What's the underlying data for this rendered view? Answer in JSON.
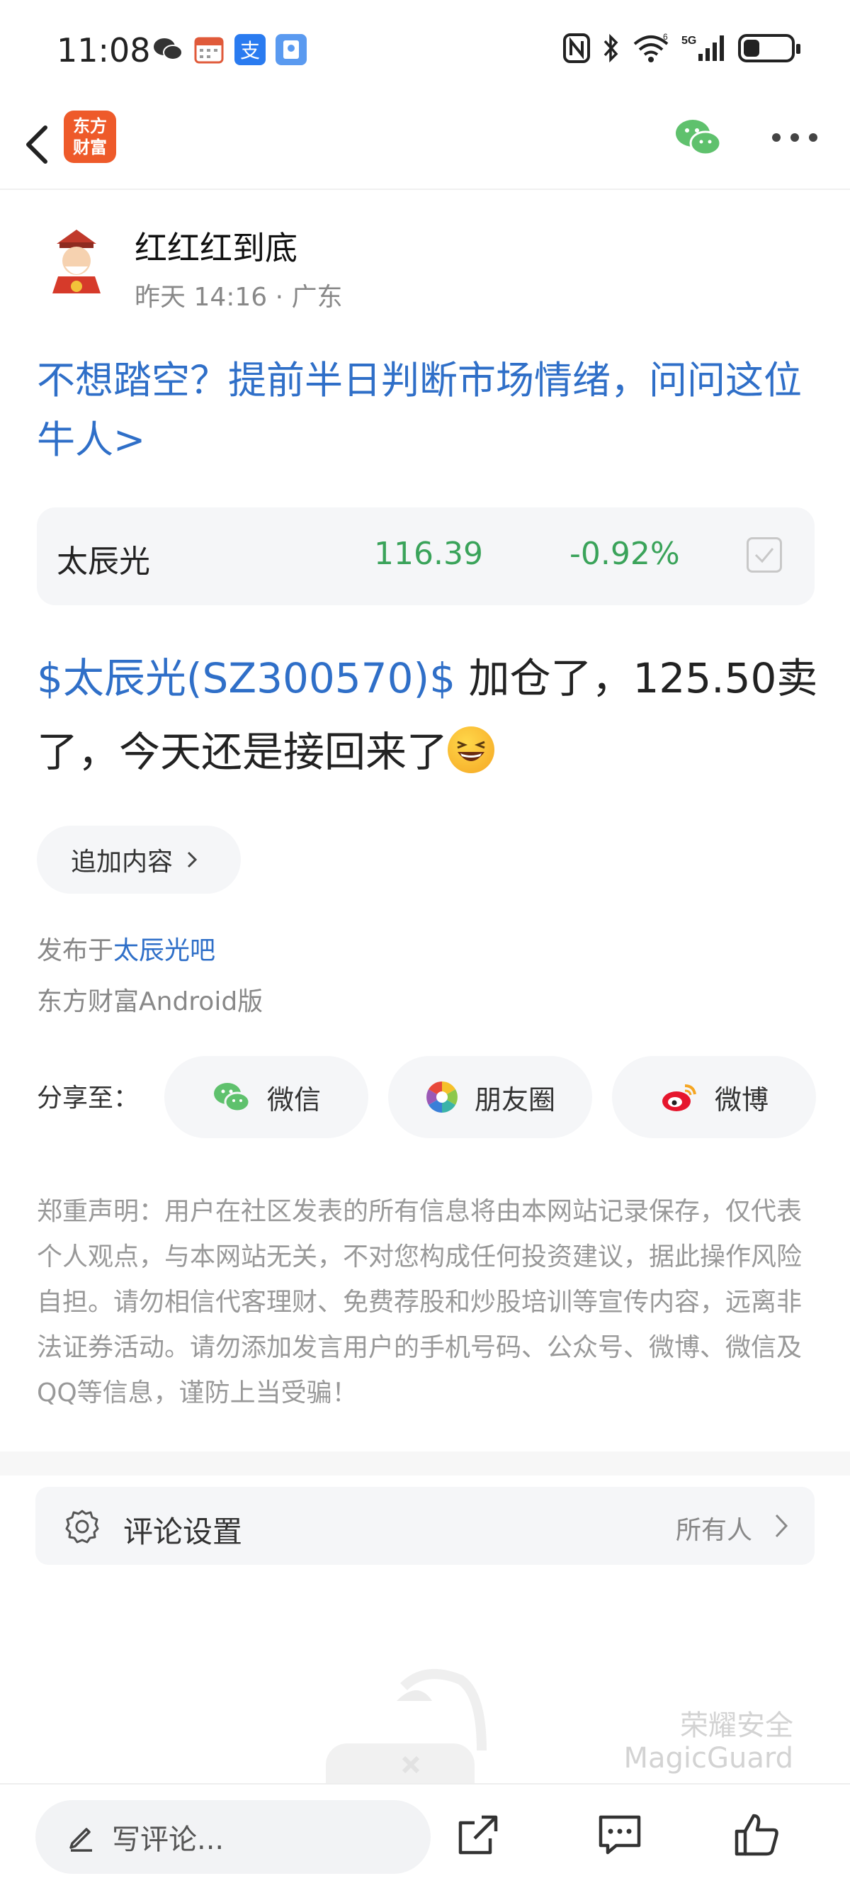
{
  "status_bar": {
    "time": "11:08",
    "network": "5G",
    "wifi_badge": "6",
    "battery_level": 0.35
  },
  "nav": {
    "logo_text_line1": "东方",
    "logo_text_line2": "财富"
  },
  "author": {
    "name": "红红红到底",
    "meta": "昨天 14:16 · 广东"
  },
  "promo_link": "不想踏空？提前半日判断市场情绪，问问这位牛人>",
  "stock": {
    "name": "太辰光",
    "price": "116.39",
    "change": "-0.92%"
  },
  "post": {
    "tag": "$太辰光(SZ300570)$",
    "text_after_tag": " 加仓了，125.50卖了，今天还是接回来了"
  },
  "add_content_label": "追加内容",
  "published": {
    "prefix": "发布于",
    "bar_name": "太辰光吧",
    "client": "东方财富Android版"
  },
  "share": {
    "label": "分享至：",
    "targets": [
      {
        "label": "微信",
        "icon": "wechat-icon"
      },
      {
        "label": "朋友圈",
        "icon": "moments-icon"
      },
      {
        "label": "微博",
        "icon": "weibo-icon"
      }
    ]
  },
  "disclaimer": "郑重声明：用户在社区发表的所有信息将由本网站记录保存，仅代表个人观点，与本网站无关，不对您构成任何投资建议，据此操作风险自担。请勿相信代客理财、免费荐股和炒股培训等宣传内容，远离非法证券活动。请勿添加发言用户的手机号码、公众号、微博、微信及QQ等信息，谨防上当受骗！",
  "comment_settings": {
    "label": "评论设置",
    "value": "所有人"
  },
  "watermark": {
    "line1": "荣耀安全",
    "line2": "MagicGuard"
  },
  "bottom_bar": {
    "comment_placeholder": "写评论..."
  },
  "colors": {
    "link_blue": "#2f6fc8",
    "down_green": "#3aa35a",
    "brand_orange": "#ee5a2a"
  }
}
